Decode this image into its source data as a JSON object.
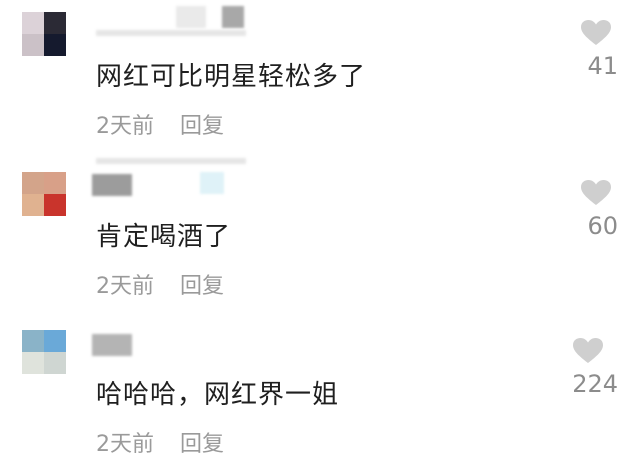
{
  "comments": [
    {
      "text": "网红可比明星轻松多了",
      "time": "2天前",
      "reply": "回复",
      "likes": "41",
      "avatar_colors": [
        "#dcd2d8",
        "#2b2a35",
        "#cbc1c7",
        "#151a2e"
      ]
    },
    {
      "text": "肯定喝酒了",
      "time": "2天前",
      "reply": "回复",
      "likes": "60",
      "avatar_colors": [
        "#d3a48a",
        "#d8a088",
        "#e0b290",
        "#c9342c"
      ]
    },
    {
      "text": "哈哈哈，网红界一姐",
      "time": "2天前",
      "reply": "回复",
      "likes": "224",
      "avatar_colors": [
        "#8ab3c8",
        "#6aa9d8",
        "#dfe3dc",
        "#cfd6d2"
      ]
    }
  ],
  "icons": {
    "like": "heart-icon"
  },
  "colors": {
    "text": "#1f1f1f",
    "meta": "#9a9a9a",
    "like_icon": "#cfcfcf",
    "like_count": "#8c8c8c"
  }
}
